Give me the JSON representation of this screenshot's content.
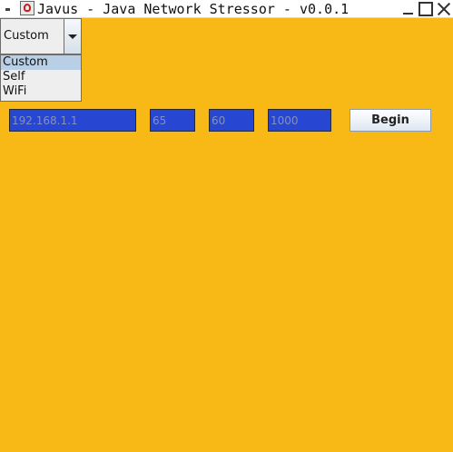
{
  "window": {
    "title": "Javus - Java Network Stressor - v0.0.1",
    "menu_icon": "window-menu-icon",
    "app_icon": "java-icon",
    "controls": [
      "minimize-icon",
      "maximize-icon",
      "close-icon"
    ],
    "background_color": "#f8b815"
  },
  "mode_select": {
    "value": "Custom",
    "options": [
      "Custom",
      "Self",
      "WiFi"
    ],
    "highlighted": "Custom"
  },
  "fields": {
    "ip": "192.168.1.1",
    "field2": "65",
    "field3": "60",
    "field4": "1000",
    "field_color": "#2747d3"
  },
  "actions": {
    "begin_label": "Begin"
  }
}
